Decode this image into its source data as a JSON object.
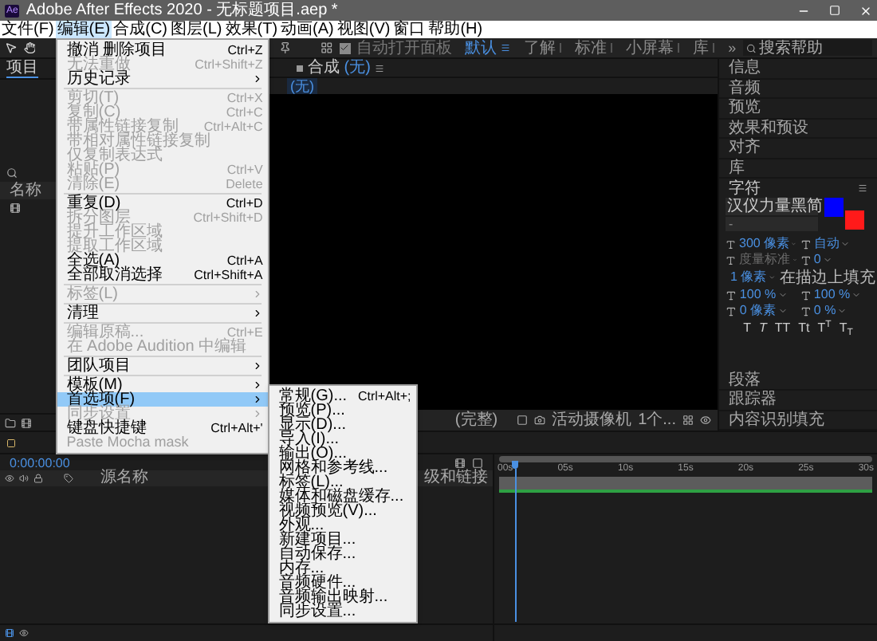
{
  "window": {
    "badge": "Ae",
    "title": "Adobe After Effects 2020 - 无标题项目.aep *"
  },
  "menubar": [
    {
      "label": "文件(F)",
      "selected": false
    },
    {
      "label": "编辑(E)",
      "selected": true
    },
    {
      "label": "合成(C)",
      "selected": false
    },
    {
      "label": "图层(L)",
      "selected": false
    },
    {
      "label": "效果(T)",
      "selected": false
    },
    {
      "label": "动画(A)",
      "selected": false
    },
    {
      "label": "视图(V)",
      "selected": false
    },
    {
      "label": "窗口",
      "selected": false
    },
    {
      "label": "帮助(H)",
      "selected": false
    }
  ],
  "edit_menu": [
    {
      "kind": "item",
      "label": "撤消 删除项目",
      "shortcut": "Ctrl+Z",
      "disabled": false,
      "submenu": false,
      "selected": false
    },
    {
      "kind": "item",
      "label": "无法重做",
      "shortcut": "Ctrl+Shift+Z",
      "disabled": true,
      "submenu": false,
      "selected": false
    },
    {
      "kind": "item",
      "label": "历史记录",
      "disabled": false,
      "submenu": true,
      "selected": false
    },
    {
      "kind": "separator"
    },
    {
      "kind": "item",
      "label": "剪切(T)",
      "shortcut": "Ctrl+X",
      "disabled": true,
      "submenu": false,
      "selected": false
    },
    {
      "kind": "item",
      "label": "复制(C)",
      "shortcut": "Ctrl+C",
      "disabled": true,
      "submenu": false,
      "selected": false
    },
    {
      "kind": "item",
      "label": "带属性链接复制",
      "shortcut": "Ctrl+Alt+C",
      "disabled": true,
      "submenu": false,
      "selected": false
    },
    {
      "kind": "item",
      "label": "带相对属性链接复制",
      "disabled": true,
      "submenu": false,
      "selected": false
    },
    {
      "kind": "item",
      "label": "仅复制表达式",
      "disabled": true,
      "submenu": false,
      "selected": false
    },
    {
      "kind": "item",
      "label": "粘贴(P)",
      "shortcut": "Ctrl+V",
      "disabled": true,
      "submenu": false,
      "selected": false
    },
    {
      "kind": "item",
      "label": "清除(E)",
      "shortcut": "Delete",
      "disabled": true,
      "submenu": false,
      "selected": false
    },
    {
      "kind": "separator"
    },
    {
      "kind": "item",
      "label": "重复(D)",
      "shortcut": "Ctrl+D",
      "disabled": false,
      "submenu": false,
      "selected": false
    },
    {
      "kind": "item",
      "label": "拆分图层",
      "shortcut": "Ctrl+Shift+D",
      "disabled": true,
      "submenu": false,
      "selected": false
    },
    {
      "kind": "item",
      "label": "提升工作区域",
      "disabled": true,
      "submenu": false,
      "selected": false
    },
    {
      "kind": "item",
      "label": "提取工作区域",
      "disabled": true,
      "submenu": false,
      "selected": false
    },
    {
      "kind": "item",
      "label": "全选(A)",
      "shortcut": "Ctrl+A",
      "disabled": false,
      "submenu": false,
      "selected": false
    },
    {
      "kind": "item",
      "label": "全部取消选择",
      "shortcut": "Ctrl+Shift+A",
      "disabled": false,
      "submenu": false,
      "selected": false
    },
    {
      "kind": "separator"
    },
    {
      "kind": "item",
      "label": "标签(L)",
      "disabled": true,
      "submenu": true,
      "selected": false
    },
    {
      "kind": "separator"
    },
    {
      "kind": "item",
      "label": "清理",
      "disabled": false,
      "submenu": true,
      "selected": false
    },
    {
      "kind": "separator"
    },
    {
      "kind": "item",
      "label": "编辑原稿...",
      "shortcut": "Ctrl+E",
      "disabled": true,
      "submenu": false,
      "selected": false
    },
    {
      "kind": "item",
      "label": "在 Adobe Audition 中编辑",
      "disabled": true,
      "submenu": false,
      "selected": false
    },
    {
      "kind": "separator"
    },
    {
      "kind": "item",
      "label": "团队项目",
      "disabled": false,
      "submenu": true,
      "selected": false
    },
    {
      "kind": "separator"
    },
    {
      "kind": "item",
      "label": "模板(M)",
      "disabled": false,
      "submenu": true,
      "selected": false
    },
    {
      "kind": "item",
      "label": "首选项(F)",
      "disabled": false,
      "submenu": true,
      "selected": true
    },
    {
      "kind": "item",
      "label": "同步设置",
      "disabled": true,
      "submenu": true,
      "selected": false
    },
    {
      "kind": "item",
      "label": "键盘快捷键",
      "shortcut": "Ctrl+Alt+'",
      "disabled": false,
      "submenu": false,
      "selected": false
    },
    {
      "kind": "item",
      "label": "Paste Mocha mask",
      "disabled": true,
      "submenu": false,
      "selected": false
    }
  ],
  "preferences_menu": [
    {
      "label": "常规(G)...",
      "shortcut": "Ctrl+Alt+;"
    },
    {
      "label": "预览(P)..."
    },
    {
      "label": "显示(D)..."
    },
    {
      "label": "导入(I)..."
    },
    {
      "label": "输出(O)..."
    },
    {
      "label": "网格和参考线..."
    },
    {
      "label": "标签(L)..."
    },
    {
      "label": "媒体和磁盘缓存..."
    },
    {
      "label": "视频预览(V)..."
    },
    {
      "label": "外观..."
    },
    {
      "label": "新建项目..."
    },
    {
      "label": "自动保存..."
    },
    {
      "label": "内存..."
    },
    {
      "label": "音频硬件..."
    },
    {
      "label": "音频输出映射..."
    },
    {
      "label": "同步设置..."
    }
  ],
  "toolbar": {
    "auto_open": {
      "label": "自动打开面板",
      "checked": true
    },
    "workspaces": [
      {
        "label": "默认",
        "selected": true
      },
      {
        "label": "了解",
        "selected": false
      },
      {
        "label": "标准",
        "selected": false
      },
      {
        "label": "小屏幕",
        "selected": false
      },
      {
        "label": "库",
        "selected": false
      }
    ],
    "overflow": "»",
    "search": {
      "placeholder": "搜索帮助"
    }
  },
  "project_panel": {
    "tab": "项目",
    "column": "名称"
  },
  "composition": {
    "tab": "合成",
    "comp_name": "(无)",
    "subtab": "(无)",
    "resolution": "(完整)",
    "camera": "活动摄像机",
    "views": "1个..."
  },
  "right_panels": [
    "信息",
    "音频",
    "预览",
    "效果和预设",
    "对齐",
    "库"
  ],
  "character": {
    "title": "字符",
    "font": "汉仪力量黑简",
    "style": "-",
    "swatches": [
      {
        "kind": "fill",
        "color": "#0000ff"
      },
      {
        "kind": "stroke",
        "color": "#ff1a1a"
      }
    ],
    "fields": [
      {
        "value": "300 像素",
        "disabled": false
      },
      {
        "value": "自动",
        "disabled": false
      },
      {
        "value": "度量标准",
        "disabled": true
      },
      {
        "value": "0",
        "disabled": false
      }
    ],
    "stroke": {
      "value": "1 像素",
      "mode": "在描边上填充"
    },
    "scale_fields": [
      {
        "value": "100 %"
      },
      {
        "value": "100 %"
      },
      {
        "value": "0 像素"
      },
      {
        "value": "0 %"
      }
    ],
    "style_buttons": [
      "T",
      "*T*",
      "TT",
      "Tt",
      "T$^{T}$",
      "T$_{T}$"
    ]
  },
  "lower_panels": [
    "段落",
    "跟踪器",
    "内容识别填充"
  ],
  "timeline": {
    "timecode": "0:00:00:00",
    "source_column": "源名称",
    "parent_column": "级和链接",
    "ruler": [
      "00s",
      "05s",
      "10s",
      "15s",
      "20s",
      "25s",
      "30s"
    ]
  }
}
